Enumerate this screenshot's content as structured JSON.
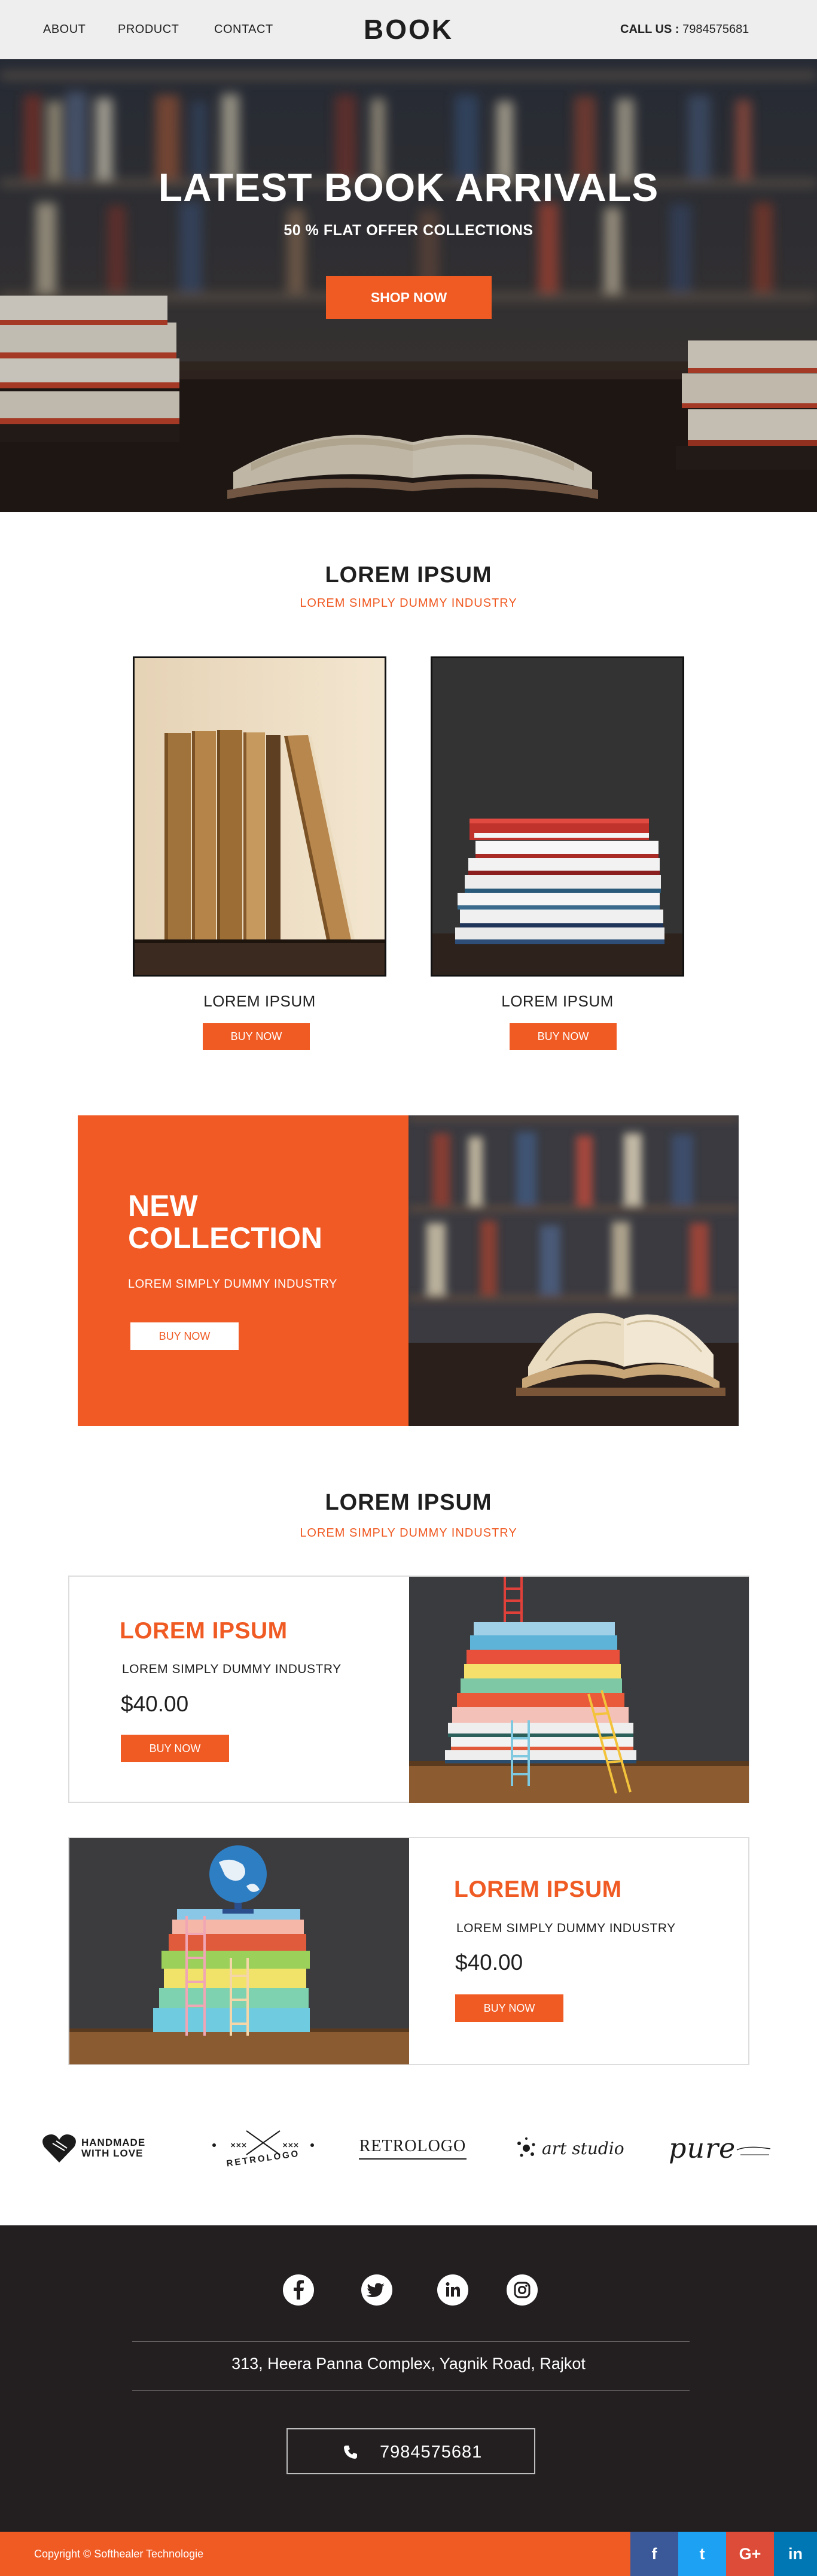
{
  "header": {
    "nav": [
      "ABOUT",
      "PRODUCT",
      "CONTACT"
    ],
    "brand": "BOOK",
    "call_label": "CALL US : ",
    "call_number": "7984575681"
  },
  "hero": {
    "title": "LATEST BOOK ARRIVALS",
    "subtitle": "50 % FLAT OFFER COLLECTIONS",
    "button": "SHOP NOW"
  },
  "section1": {
    "title": "LOREM IPSUM",
    "subtitle": "LOREM SIMPLY DUMMY INDUSTRY",
    "products": [
      {
        "name": "LOREM IPSUM",
        "button": "BUY NOW"
      },
      {
        "name": "LOREM IPSUM",
        "button": "BUY NOW"
      }
    ]
  },
  "collection": {
    "title_line1": "NEW",
    "title_line2": "COLLECTION",
    "subtitle": "LOREM SIMPLY DUMMY INDUSTRY",
    "button": "BUY NOW"
  },
  "section2": {
    "title": "LOREM IPSUM",
    "subtitle": "LOREM SIMPLY DUMMY INDUSTRY",
    "features": [
      {
        "title": "LOREM IPSUM",
        "desc": "LOREM SIMPLY DUMMY INDUSTRY",
        "price": "$40.00",
        "button": "BUY NOW"
      },
      {
        "title": "LOREM IPSUM",
        "desc": "LOREM SIMPLY DUMMY INDUSTRY",
        "price": "$40.00",
        "button": "BUY NOW"
      }
    ]
  },
  "logos": [
    {
      "name": "handmade-logo",
      "text": "HANDMADE\nWITH LOVE"
    },
    {
      "name": "retrologo-badge",
      "text": "RETROLOGO"
    },
    {
      "name": "retrologo-wordmark",
      "text": "RETROLOGO"
    },
    {
      "name": "art-studio-logo",
      "text": "art studio"
    },
    {
      "name": "pure-logo",
      "text": "pure"
    }
  ],
  "footer": {
    "social": [
      "facebook-icon",
      "twitter-icon",
      "linkedin-icon",
      "instagram-icon"
    ],
    "address": "313, Heera Panna Complex, Yagnik Road, Rajkot",
    "phone": "7984575681",
    "copyright": "Copyright © Softhealer Technologie",
    "bar_social": [
      {
        "icon": "facebook-icon",
        "label": "f",
        "color": "#3b5998"
      },
      {
        "icon": "twitter-icon",
        "label": "t",
        "color": "#1da1f2"
      },
      {
        "icon": "google-plus-icon",
        "label": "G+",
        "color": "#dd4b39"
      },
      {
        "icon": "linkedin-icon",
        "label": "in",
        "color": "#0077b5"
      }
    ]
  },
  "colors": {
    "accent": "#f05a23",
    "dark": "#231f20",
    "header_bg": "#eeeeee"
  }
}
